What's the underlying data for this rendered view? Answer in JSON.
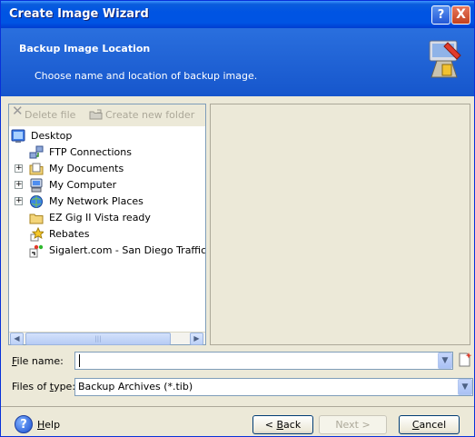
{
  "window": {
    "title": "Create Image Wizard",
    "help_glyph": "?",
    "close_glyph": "X"
  },
  "banner": {
    "title": "Backup Image Location",
    "subtitle": "Choose name and location of backup image.",
    "icon": "wizard-backup-icon"
  },
  "toolbar": {
    "delete_label": "Delete file",
    "new_folder_label": "Create new folder"
  },
  "tree": {
    "items": [
      {
        "label": "Desktop",
        "icon": "desktop-icon",
        "expandable": false
      },
      {
        "label": "FTP Connections",
        "icon": "ftp-icon",
        "expandable": false
      },
      {
        "label": "My Documents",
        "icon": "documents-folder-icon",
        "expandable": true
      },
      {
        "label": "My Computer",
        "icon": "computer-icon",
        "expandable": true
      },
      {
        "label": "My Network Places",
        "icon": "network-icon",
        "expandable": true
      },
      {
        "label": "EZ Gig II Vista ready",
        "icon": "folder-icon",
        "expandable": false
      },
      {
        "label": "Rebates",
        "icon": "star-folder-icon",
        "expandable": false
      },
      {
        "label": "Sigalert.com - San Diego Traffic R",
        "icon": "traffic-link-icon",
        "expandable": false
      }
    ],
    "expander_glyph": "+"
  },
  "file_name": {
    "label_prefix": "",
    "label_accel": "F",
    "label_rest": "ile name:",
    "value": ""
  },
  "file_type": {
    "label_prefix": "Files of ",
    "label_accel": "t",
    "label_rest": "ype:",
    "value": "Backup Archives (*.tib)"
  },
  "footer": {
    "help_accel": "H",
    "help_rest": "elp",
    "back_prefix": "< ",
    "back_accel": "B",
    "back_rest": "ack",
    "next_label": "Next >",
    "cancel_accel": "C",
    "cancel_rest": "ancel"
  },
  "colors": {
    "titlebar": "#0054e3",
    "banner": "#1656cc",
    "dialog_bg": "#ece9d8"
  }
}
